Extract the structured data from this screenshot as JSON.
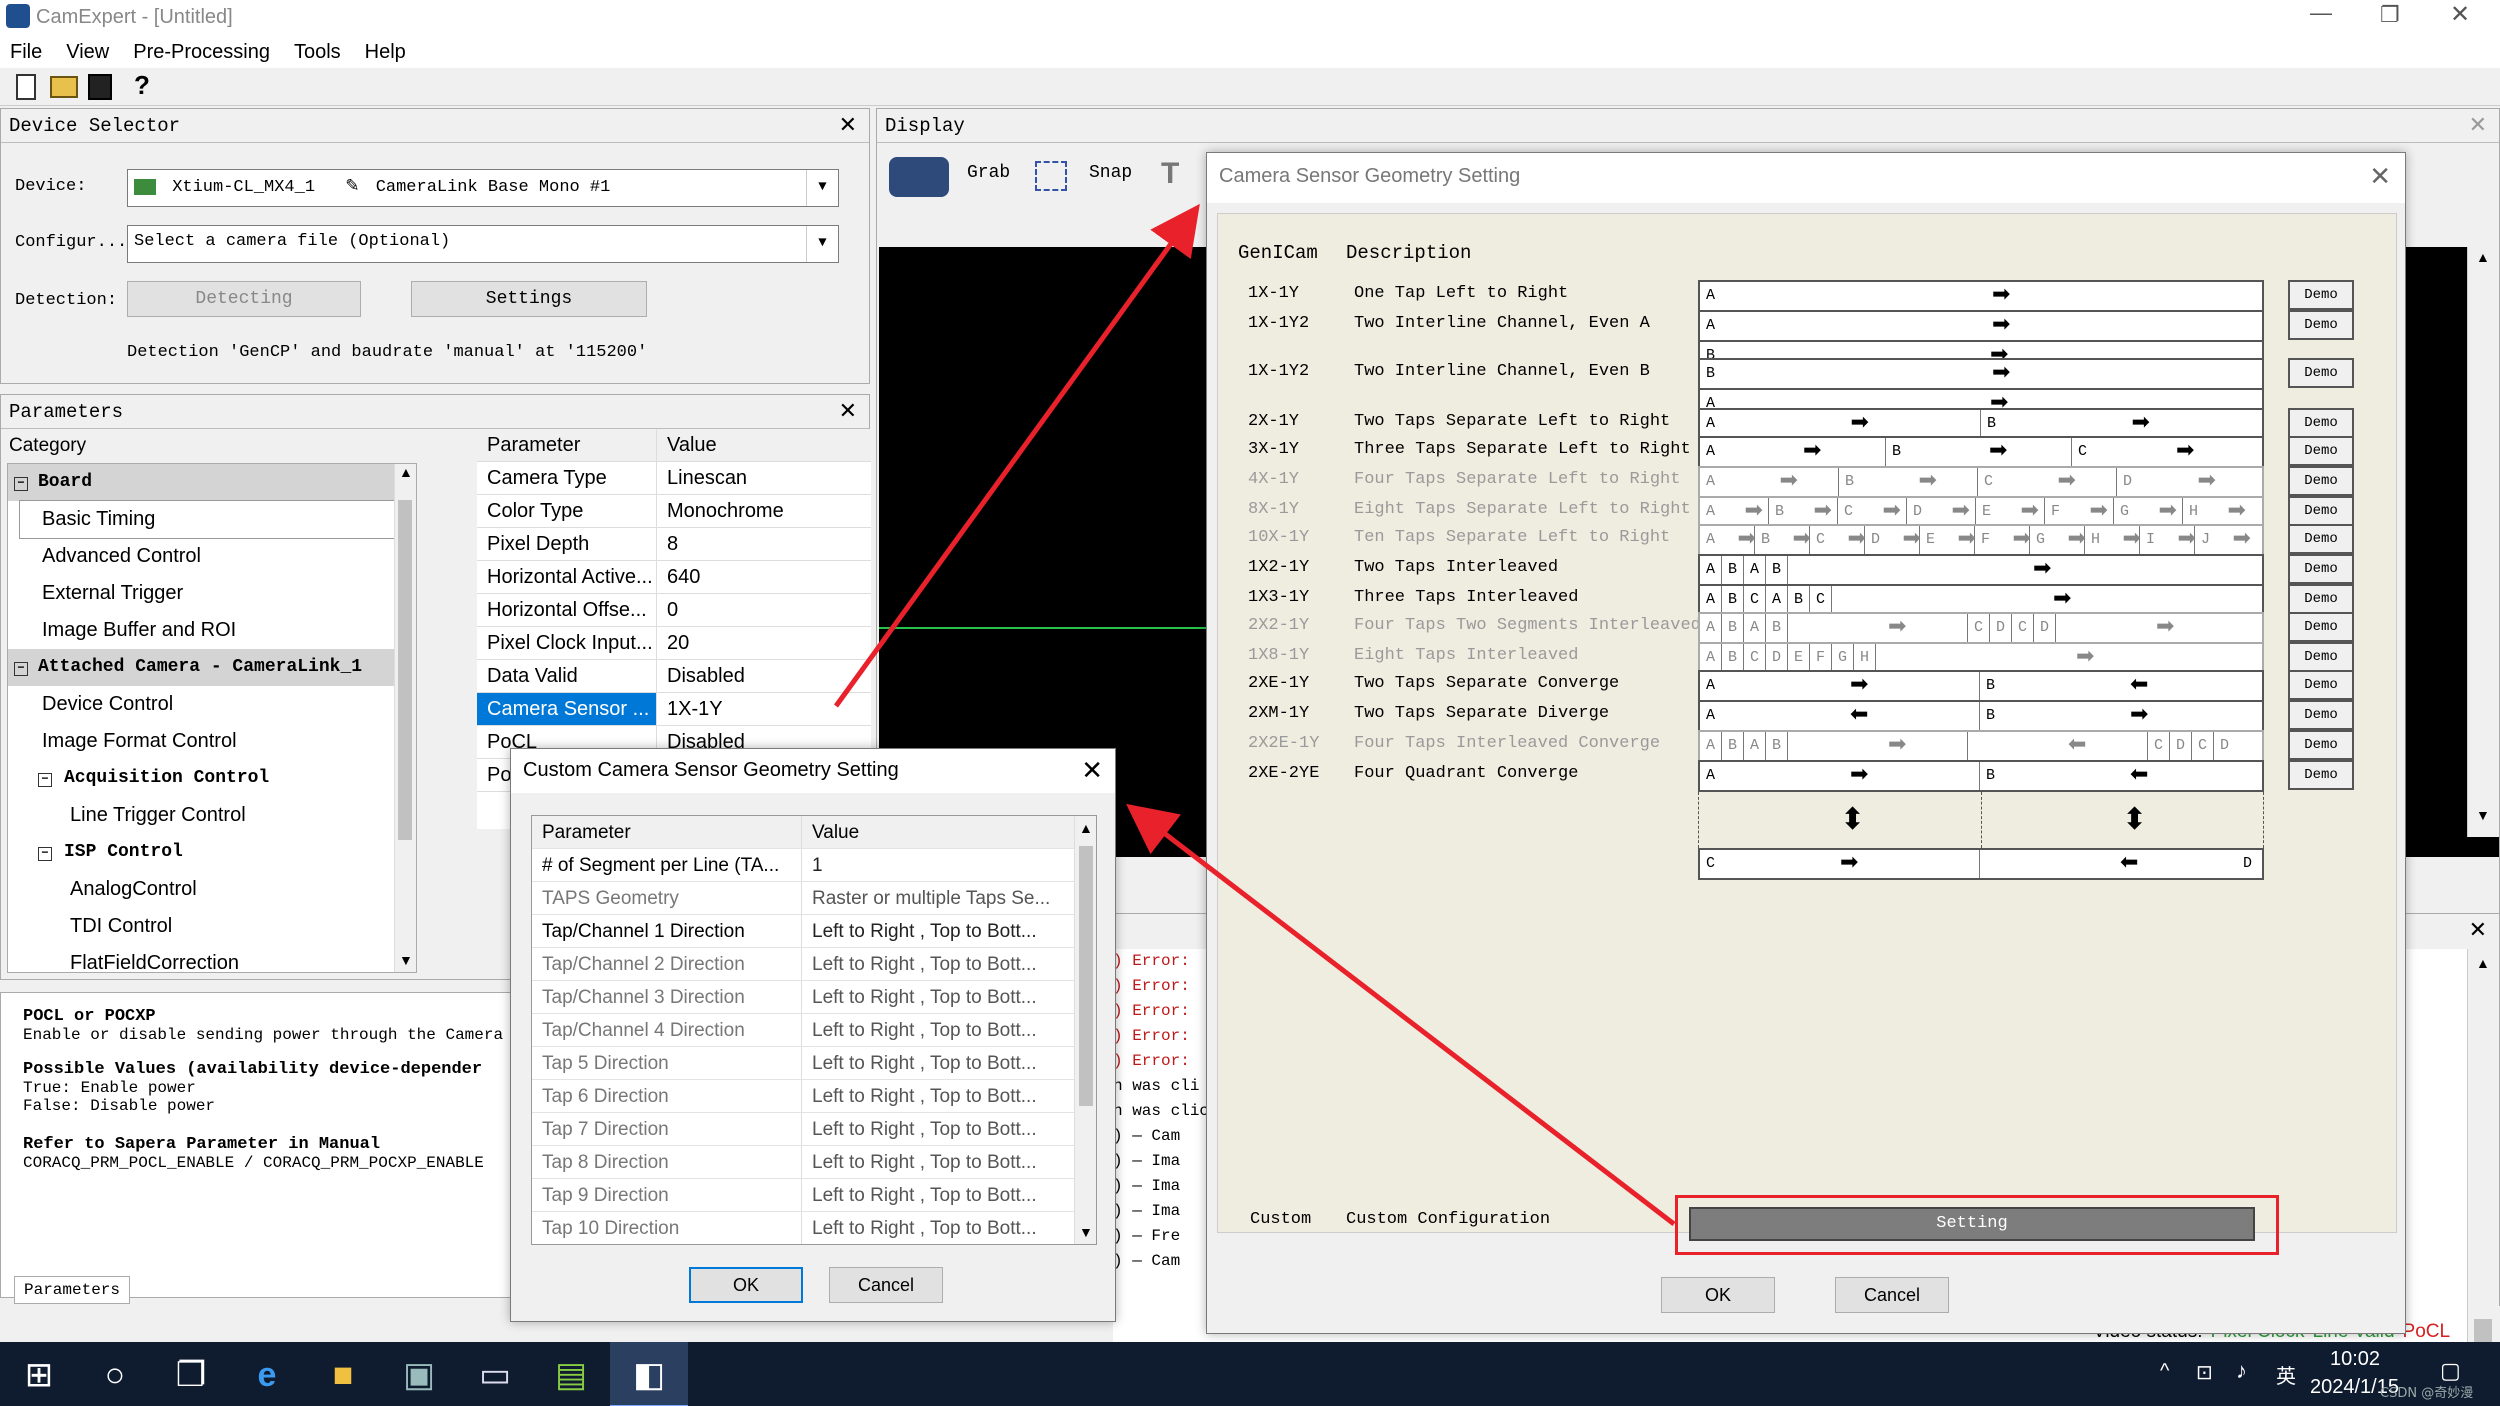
{
  "window": {
    "title": "CamExpert - [Untitled]"
  },
  "menu": [
    "File",
    "View",
    "Pre-Processing",
    "Tools",
    "Help"
  ],
  "device_selector": {
    "title": "Device Selector",
    "device_label": "Device:",
    "device_value": "Xtium-CL_MX4_1",
    "device_sub": "CameraLink Base Mono #1",
    "config_label": "Configur...",
    "config_value": "Select a camera file (Optional)",
    "detection_label": "Detection:",
    "detecting_button": "Detecting",
    "settings_button": "Settings",
    "detection_text": "Detection 'GenCP' and baudrate 'manual' at '115200'"
  },
  "parameters": {
    "title": "Parameters",
    "category_header": "Category",
    "param_header": "Parameter",
    "value_header": "Value",
    "categories": [
      {
        "label": "Board",
        "kind": "group"
      },
      {
        "label": "Basic Timing",
        "kind": "item",
        "selected": true
      },
      {
        "label": "Advanced Control",
        "kind": "item"
      },
      {
        "label": "External Trigger",
        "kind": "item"
      },
      {
        "label": "Image Buffer and ROI",
        "kind": "item"
      },
      {
        "label": "Attached Camera - CameraLink_1",
        "kind": "group"
      },
      {
        "label": "Device Control",
        "kind": "item"
      },
      {
        "label": "Image Format Control",
        "kind": "item"
      },
      {
        "label": "Acquisition Control",
        "kind": "subgroup"
      },
      {
        "label": "Line Trigger Control",
        "kind": "subitem"
      },
      {
        "label": "ISP Control",
        "kind": "subgroup"
      },
      {
        "label": "AnalogControl",
        "kind": "subitem"
      },
      {
        "label": "TDI Control",
        "kind": "subitem"
      },
      {
        "label": "FlatFieldCorrection",
        "kind": "subitem"
      }
    ],
    "rows": [
      {
        "k": "Camera Type",
        "v": "Linescan"
      },
      {
        "k": "Color Type",
        "v": "Monochrome"
      },
      {
        "k": "Pixel Depth",
        "v": "8"
      },
      {
        "k": "Horizontal Active...",
        "v": "640"
      },
      {
        "k": "Horizontal Offse...",
        "v": "0"
      },
      {
        "k": "Pixel Clock Input...",
        "v": "20"
      },
      {
        "k": "Data Valid",
        "v": "Disabled"
      },
      {
        "k": "Camera Sensor ...",
        "v": "1X-1Y",
        "selected": true
      },
      {
        "k": "PoCL",
        "v": "Disabled"
      },
      {
        "k": "Po",
        "v": ""
      }
    ],
    "tab_label": "Parameters"
  },
  "help": {
    "title": "POCL or POCXP",
    "line1": "Enable or disable sending power through the Camera L",
    "possible": "Possible Values (availability device-depender",
    "true_line": "True: Enable power",
    "false_line": "False: Disable power",
    "refer": "Refer to Sapera Parameter in Manual",
    "refer_line": "CORACQ_PRM_POCL_ENABLE / CORACQ_PRM_POCXP_ENABLE"
  },
  "display": {
    "title": "Display",
    "grab": "Grab",
    "snap": "Snap"
  },
  "output_log": {
    "lines": [
      ") Error:",
      ") Error:",
      ") Error:",
      ") Error:",
      ") Error:",
      "n was cli",
      "n was clic",
      ") — Cam",
      ") — Ima",
      ") — Ima",
      ") — Ima",
      ") — Fre",
      ") — Cam"
    ]
  },
  "geometry_dialog": {
    "title": "Camera Sensor Geometry Setting",
    "col_genicam": "GenICam",
    "col_desc": "Description",
    "demo": "Demo",
    "rows": [
      {
        "g": "1X-1Y",
        "d": "One Tap Left to Right",
        "dim": false
      },
      {
        "g": "1X-1Y2",
        "d": "Two Interline Channel, Even A",
        "dim": false
      },
      {
        "g": "1X-1Y2",
        "d": "Two Interline Channel, Even B",
        "dim": false
      },
      {
        "g": "2X-1Y",
        "d": "Two Taps Separate Left to Right",
        "dim": false
      },
      {
        "g": "3X-1Y",
        "d": "Three Taps Separate Left to Right",
        "dim": false
      },
      {
        "g": "4X-1Y",
        "d": "Four Taps Separate Left to Right",
        "dim": true
      },
      {
        "g": "8X-1Y",
        "d": "Eight Taps Separate Left to Right",
        "dim": true
      },
      {
        "g": "10X-1Y",
        "d": "Ten Taps Separate Left to Right",
        "dim": true
      },
      {
        "g": "1X2-1Y",
        "d": "Two Taps Interleaved",
        "dim": false
      },
      {
        "g": "1X3-1Y",
        "d": "Three Taps Interleaved",
        "dim": false
      },
      {
        "g": "2X2-1Y",
        "d": "Four Taps Two Segments Interleaved",
        "dim": true
      },
      {
        "g": "1X8-1Y",
        "d": "Eight Taps Interleaved",
        "dim": true
      },
      {
        "g": "2XE-1Y",
        "d": "Two Taps Separate Converge",
        "dim": false
      },
      {
        "g": "2XM-1Y",
        "d": "Two Taps Separate Diverge",
        "dim": false
      },
      {
        "g": "2X2E-1Y",
        "d": "Four Taps Interleaved Converge",
        "dim": true
      },
      {
        "g": "2XE-2YE",
        "d": "Four Quadrant Converge",
        "dim": false
      }
    ],
    "custom_g": "Custom",
    "custom_d": "Custom Configuration",
    "setting_button": "Setting",
    "ok": "OK",
    "cancel": "Cancel"
  },
  "custom_dialog": {
    "title": "Custom Camera Sensor Geometry Setting",
    "param_header": "Parameter",
    "value_header": "Value",
    "rows": [
      {
        "k": "# of Segment per Line (TA...",
        "v": "1",
        "dim": false
      },
      {
        "k": "TAPS Geometry",
        "v": "Raster or multiple Taps Se...",
        "dim": true
      },
      {
        "k": "Tap/Channel 1 Direction",
        "v": "Left to Right , Top to Bott...",
        "dim": false
      },
      {
        "k": "Tap/Channel 2 Direction",
        "v": "Left to Right , Top to Bott...",
        "dim": true
      },
      {
        "k": "Tap/Channel 3 Direction",
        "v": "Left to Right , Top to Bott...",
        "dim": true
      },
      {
        "k": "Tap/Channel 4 Direction",
        "v": "Left to Right , Top to Bott...",
        "dim": true
      },
      {
        "k": "Tap 5 Direction",
        "v": "Left to Right , Top to Bott...",
        "dim": true
      },
      {
        "k": "Tap 6 Direction",
        "v": "Left to Right , Top to Bott...",
        "dim": true
      },
      {
        "k": "Tap 7 Direction",
        "v": "Left to Right , Top to Bott...",
        "dim": true
      },
      {
        "k": "Tap 8 Direction",
        "v": "Left to Right , Top to Bott...",
        "dim": true
      },
      {
        "k": "Tap 9 Direction",
        "v": "Left to Right , Top to Bott...",
        "dim": true
      },
      {
        "k": "Tap 10 Direction",
        "v": "Left to Right , Top to Bott...",
        "dim": true
      }
    ],
    "ok": "OK",
    "cancel": "Cancel"
  },
  "status": {
    "video_status": "Video status:",
    "pixel_clock": "Pixel Clock",
    "line_valid": "Line Valid",
    "pocl": "PoCL"
  },
  "taskbar": {
    "time": "10:02",
    "date": "2024/1/15",
    "ime": "英",
    "watermark": "CSDN @奇妙漫"
  },
  "colors": {
    "accent": "#0078d7",
    "annotation": "#e8212b",
    "taskbar": "#0f1b2f"
  }
}
